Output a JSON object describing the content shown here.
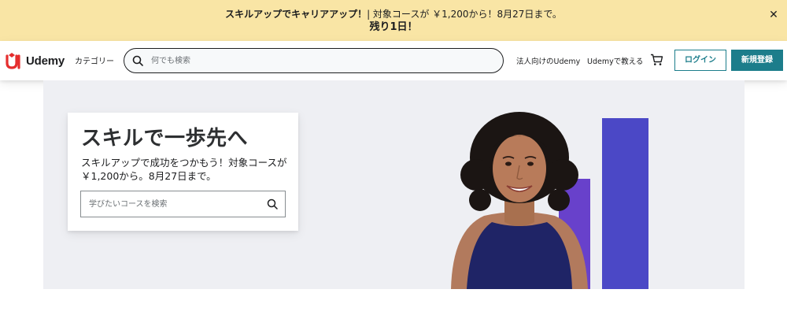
{
  "promo": {
    "line1_strong": "スキルアップでキャリアアップ！",
    "line1_rest": "| 対象コースが ￥1,200から！8月27日まで。",
    "line2": "残り1日！",
    "close_icon": "close-icon"
  },
  "header": {
    "logo_text": "Udemy",
    "category_label": "カテゴリー",
    "search_placeholder": "何でも検索",
    "business_label": "法人向けのUdemy",
    "teach_label": "Udemyで教える",
    "cart_icon": "cart-icon",
    "login_label": "ログイン",
    "signup_label": "新規登録"
  },
  "hero": {
    "title": "スキルで一歩先へ",
    "subtitle": "スキルアップで成功をつかもう！対象コースが￥1,200から。8月27日まで。",
    "search_placeholder": "学びたいコースを検索"
  },
  "colors": {
    "banner_bg": "#f9e5a5",
    "brand_teal": "#1c7d8b",
    "hero_bg": "#eeeff3",
    "bar_purple": "#4b48c6",
    "logo_red": "#a435f0"
  }
}
